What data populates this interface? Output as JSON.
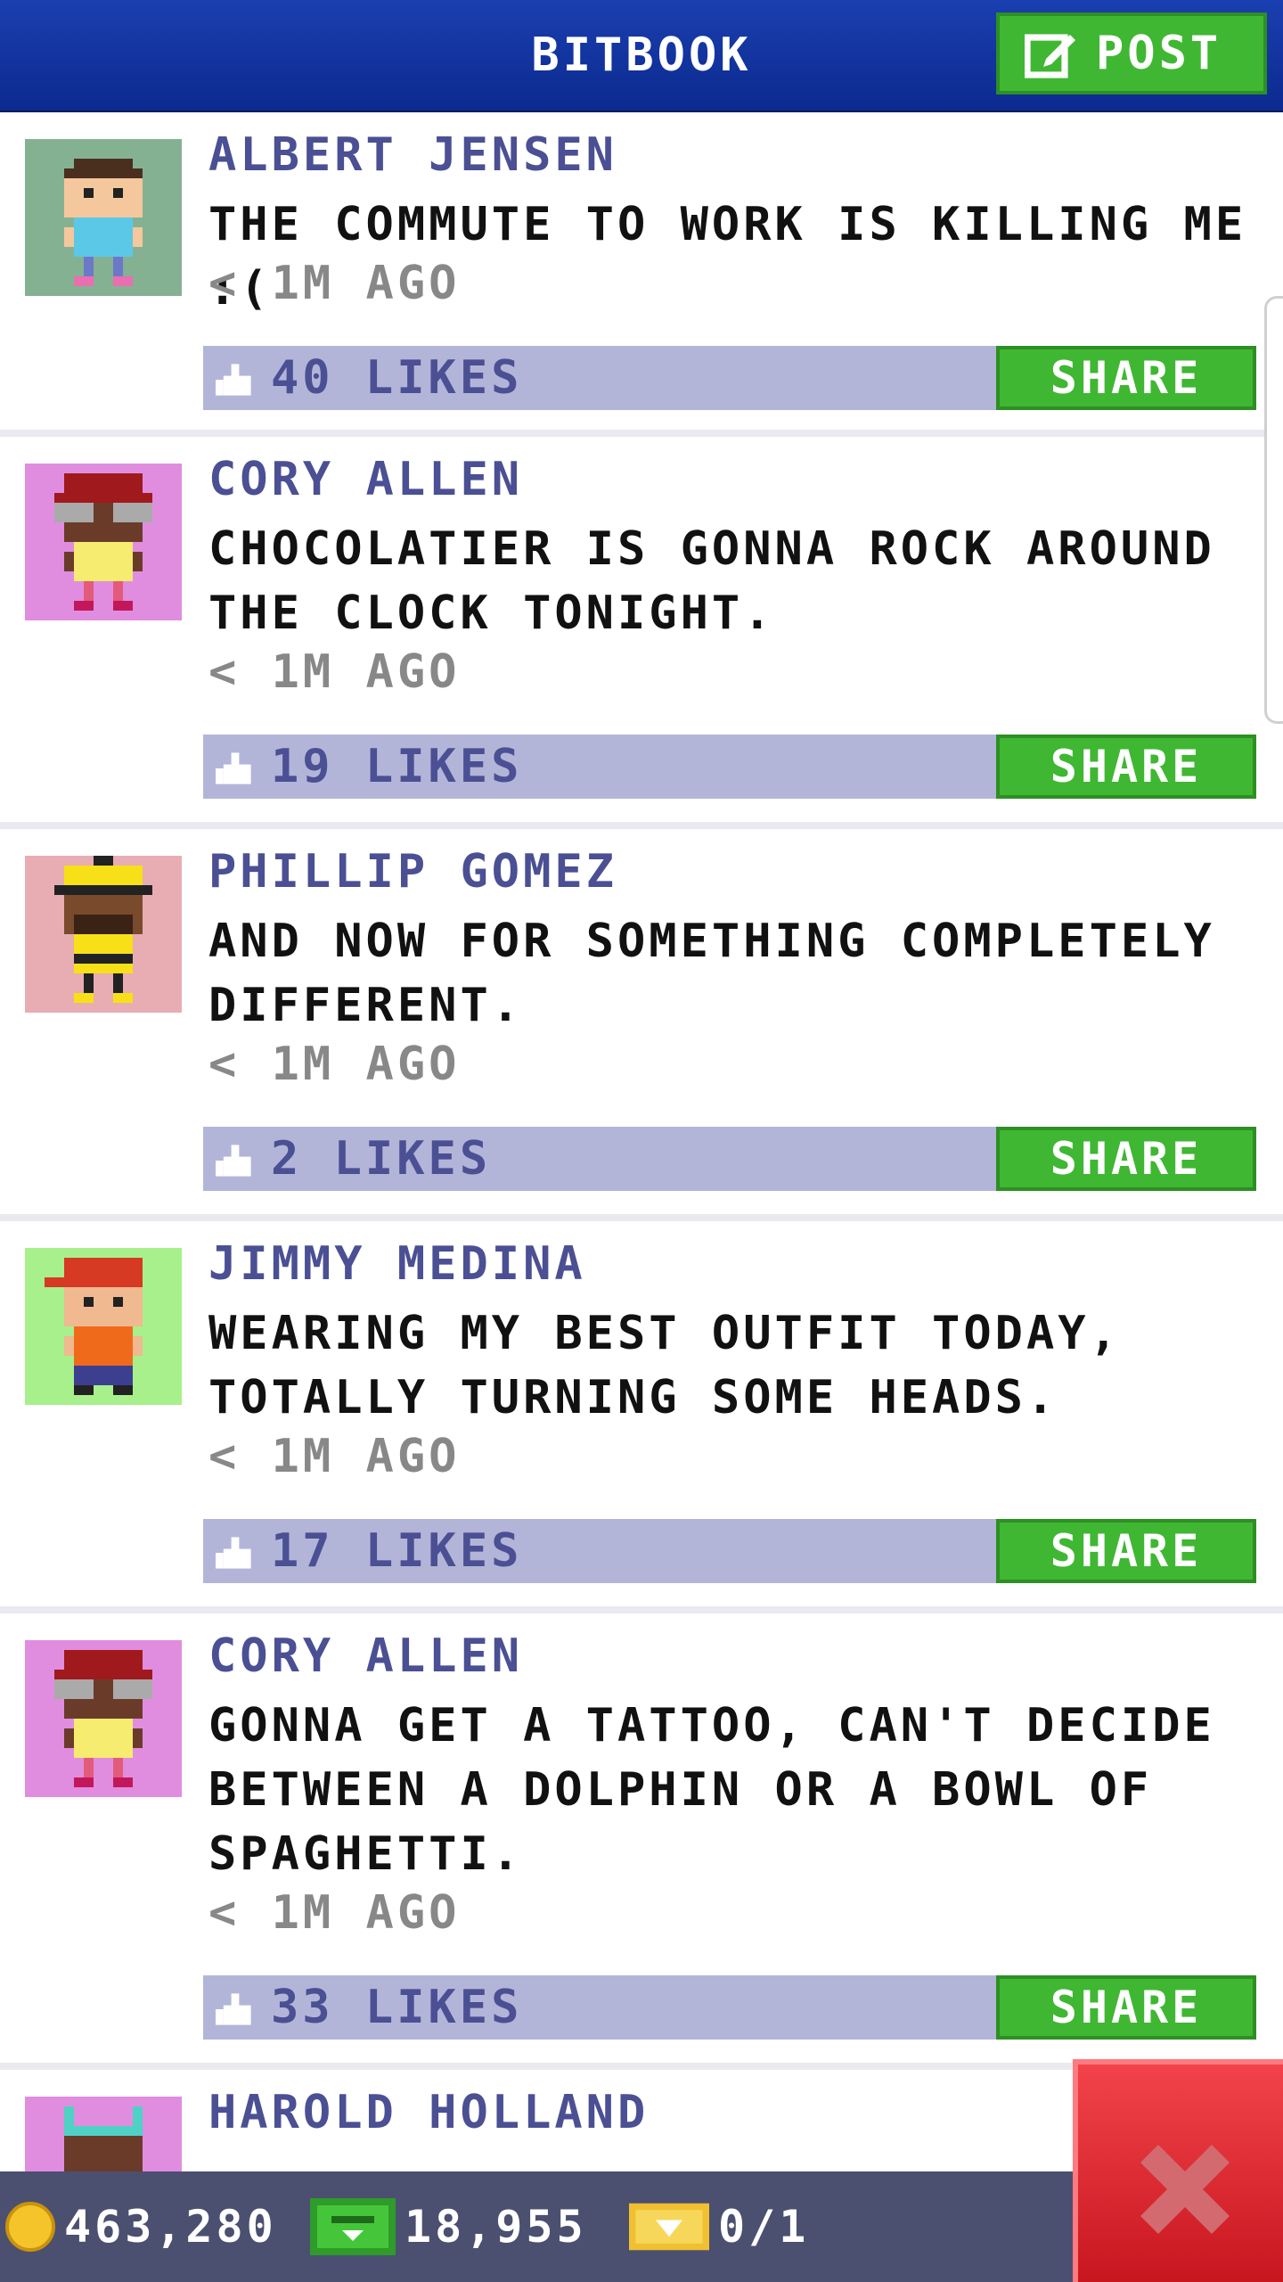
{
  "header": {
    "title": "BITBOOK",
    "post_label": "POST"
  },
  "posts": [
    {
      "author": "ALBERT JENSEN",
      "message": "THE COMMUTE TO WORK IS KILLING ME :(",
      "time": "< 1M AGO",
      "likes": "40 LIKES",
      "share": "SHARE",
      "avatar_bg": "#85b193",
      "avatar_icon": "avatar-albert-jensen"
    },
    {
      "author": "CORY ALLEN",
      "message": "CHOCOLATIER IS GONNA ROCK AROUND\nTHE CLOCK TONIGHT.",
      "time": "< 1M AGO",
      "likes": "19 LIKES",
      "share": "SHARE",
      "avatar_bg": "#e08de0",
      "avatar_icon": "avatar-cory-allen"
    },
    {
      "author": "PHILLIP GOMEZ",
      "message": "AND NOW FOR SOMETHING COMPLETELY\nDIFFERENT.",
      "time": "< 1M AGO",
      "likes": "2 LIKES",
      "share": "SHARE",
      "avatar_bg": "#e8adb2",
      "avatar_icon": "avatar-phillip-gomez"
    },
    {
      "author": "JIMMY MEDINA",
      "message": "WEARING MY BEST OUTFIT TODAY,\nTOTALLY TURNING SOME HEADS.",
      "time": "< 1M AGO",
      "likes": "17 LIKES",
      "share": "SHARE",
      "avatar_bg": "#a7f08b",
      "avatar_icon": "avatar-jimmy-medina"
    },
    {
      "author": "CORY ALLEN",
      "message": "GONNA GET A TATTOO, CAN'T DECIDE\nBETWEEN A DOLPHIN OR A BOWL OF\nSPAGHETTI.",
      "time": "< 1M AGO",
      "likes": "33 LIKES",
      "share": "SHARE",
      "avatar_bg": "#e08de0",
      "avatar_icon": "avatar-cory-allen"
    },
    {
      "author": "HAROLD HOLLAND",
      "message": "",
      "time": "",
      "likes": "",
      "share": "",
      "avatar_bg": "#e08de0",
      "avatar_icon": "avatar-harold-holland"
    }
  ],
  "status": {
    "coins": "463,280",
    "bux": "18,955",
    "tickets": "0/1"
  },
  "colors": {
    "header": "#1a3fb0",
    "accent_green": "#3fb732",
    "like_bar": "#b3b5d8",
    "author_text": "#4b4f93",
    "close_red": "#e0222b"
  },
  "icons": {
    "post": "edit-icon",
    "like": "thumbs-up-icon",
    "close": "close-icon",
    "coin": "coin-icon",
    "bux": "bux-icon",
    "ticket": "ticket-icon"
  }
}
